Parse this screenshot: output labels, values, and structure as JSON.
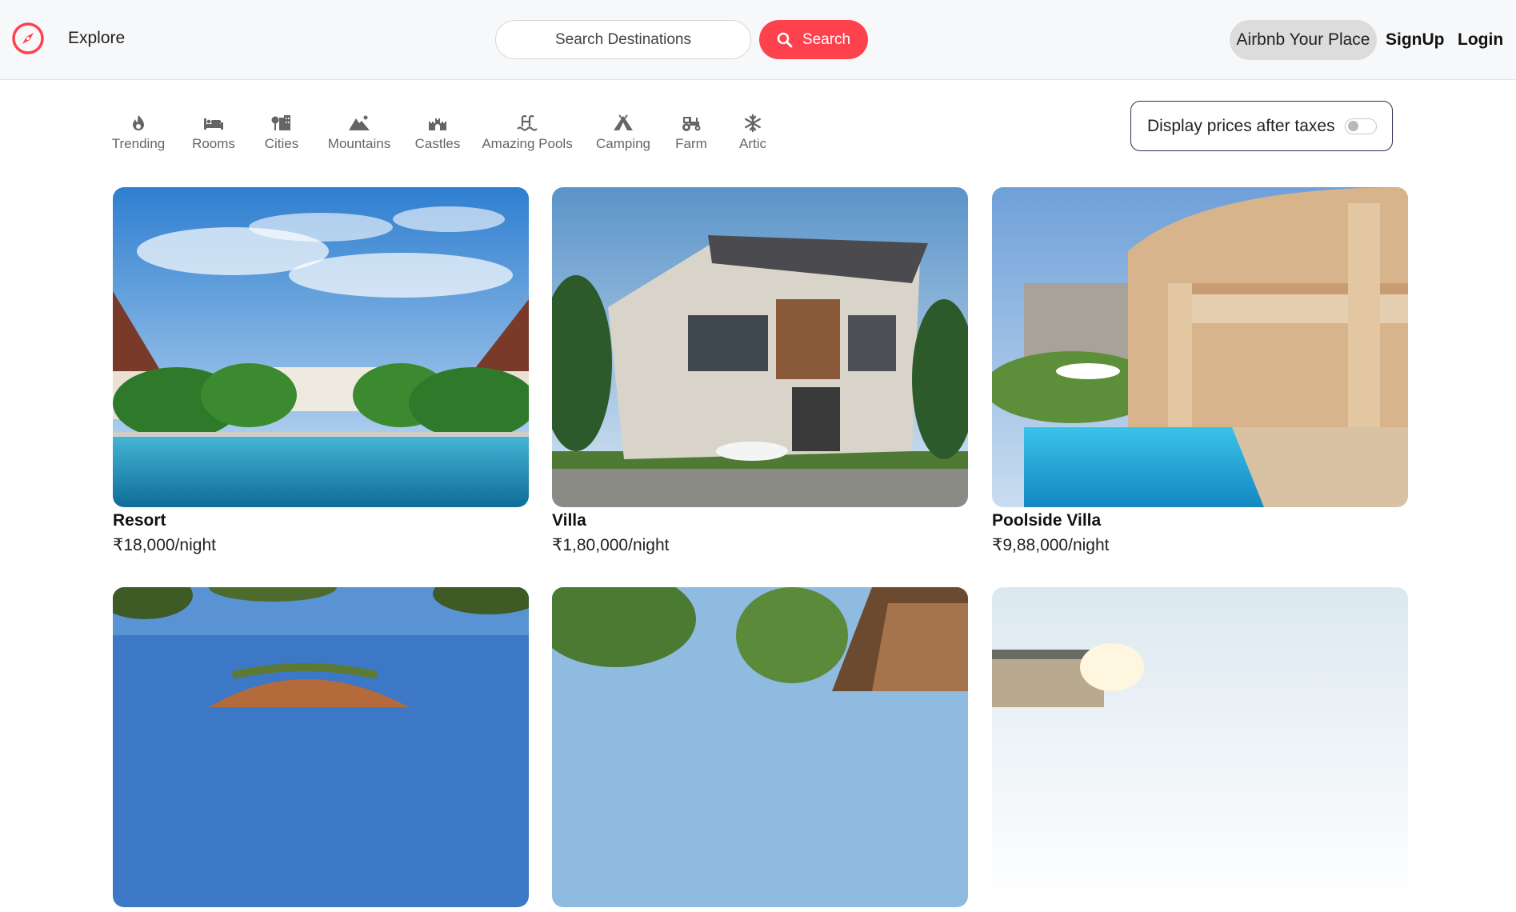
{
  "navbar": {
    "explore_label": "Explore",
    "search_placeholder": "Search Destinations",
    "search_button_label": "Search",
    "host_label": "Airbnb Your Place",
    "signup_label": "SignUp",
    "login_label": "Login",
    "brand_color": "#fe424d"
  },
  "filters": [
    {
      "label": "Trending",
      "icon": "fire-icon"
    },
    {
      "label": "Rooms",
      "icon": "bed-icon"
    },
    {
      "label": "Cities",
      "icon": "city-icon"
    },
    {
      "label": "Mountains",
      "icon": "mountain-icon"
    },
    {
      "label": "Castles",
      "icon": "castle-icon"
    },
    {
      "label": "Amazing Pools",
      "icon": "pool-icon"
    },
    {
      "label": "Camping",
      "icon": "tent-icon"
    },
    {
      "label": "Farm",
      "icon": "tractor-icon"
    },
    {
      "label": "Artic",
      "icon": "snowflake-icon"
    }
  ],
  "tax_toggle": {
    "label": "Display prices after taxes",
    "enabled": false
  },
  "listings": [
    {
      "title": "Resort",
      "price": "₹18,000/night"
    },
    {
      "title": "Villa",
      "price": "₹1,80,000/night"
    },
    {
      "title": "Poolside Villa",
      "price": "₹9,88,000/night"
    },
    {
      "title": "",
      "price": ""
    },
    {
      "title": "",
      "price": ""
    },
    {
      "title": "",
      "price": ""
    }
  ]
}
